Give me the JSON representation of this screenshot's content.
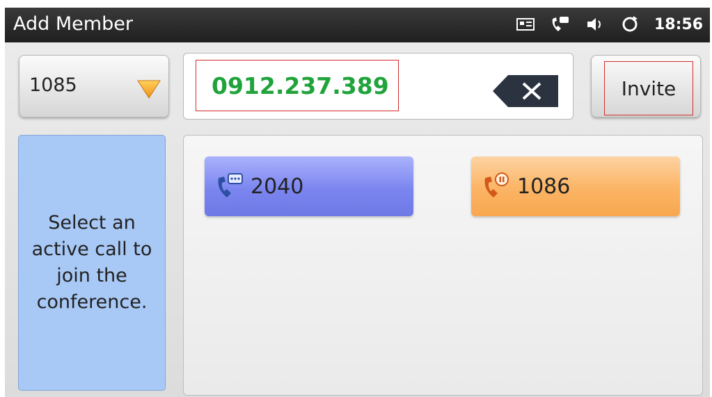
{
  "header": {
    "title": "Add Member",
    "time": "18:56"
  },
  "account": {
    "selected": "1085"
  },
  "dial": {
    "number": "0912.237.389"
  },
  "invite": {
    "label": "Invite"
  },
  "hint": {
    "text": "Select an active call to join the conference."
  },
  "calls": [
    {
      "number": "2040",
      "icon": "phone-chat-icon",
      "color": "#7b85ef"
    },
    {
      "number": "1086",
      "icon": "phone-hold-icon",
      "color": "#fbb464"
    }
  ],
  "colors": {
    "number_text": "#1fa33a",
    "hint_bg": "#a8c8f5",
    "dropdown_triangle": "#f5a623"
  }
}
